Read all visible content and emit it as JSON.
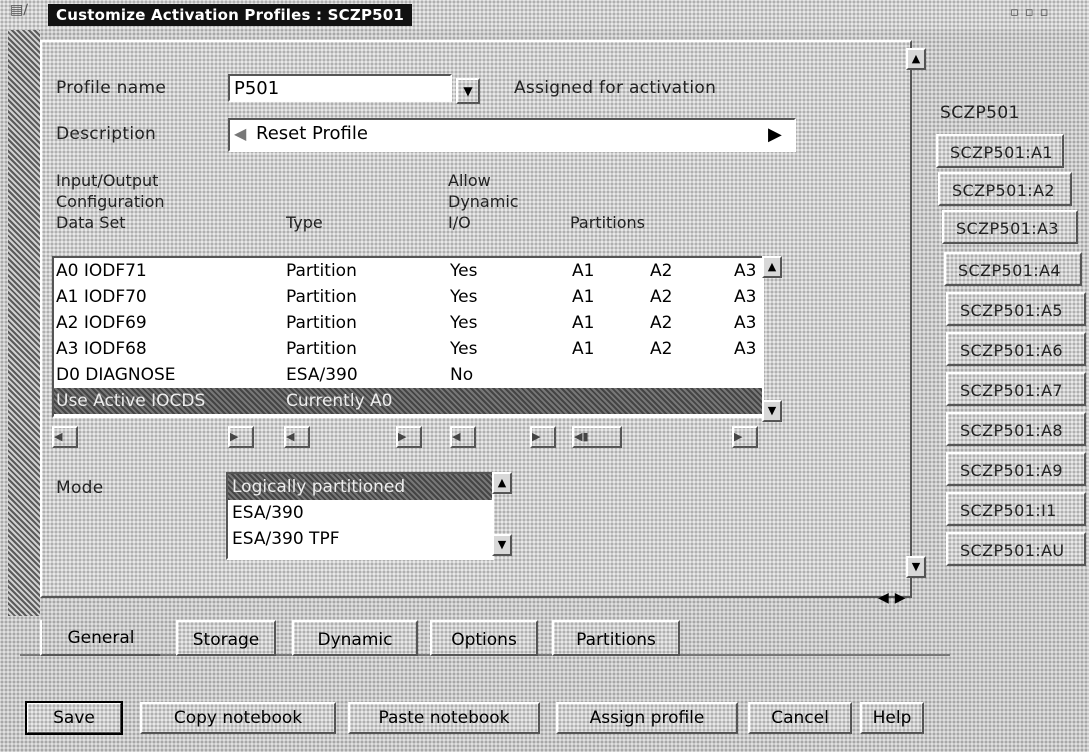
{
  "window": {
    "title": "Customize Activation Profiles : SCZP501"
  },
  "general": {
    "profile_name_label": "Profile name",
    "profile_name_value": "P501",
    "assigned_label": "Assigned for activation",
    "description_label": "Description",
    "description_value": "Reset Profile"
  },
  "iocds_table": {
    "headers": {
      "iocds": [
        "Input/Output",
        "Configuration",
        "Data Set"
      ],
      "type": "Type",
      "dynamic_io": [
        "Allow",
        "Dynamic",
        "I/O"
      ],
      "partitions": "Partitions"
    },
    "rows": [
      {
        "ds": "A0 IODF71",
        "type": "Partition",
        "io": "Yes",
        "p1": "A1",
        "p2": "A2",
        "p3": "A3"
      },
      {
        "ds": "A1 IODF70",
        "type": "Partition",
        "io": "Yes",
        "p1": "A1",
        "p2": "A2",
        "p3": "A3"
      },
      {
        "ds": "A2 IODF69",
        "type": "Partition",
        "io": "Yes",
        "p1": "A1",
        "p2": "A2",
        "p3": "A3"
      },
      {
        "ds": "A3 IODF68",
        "type": "Partition",
        "io": "Yes",
        "p1": "A1",
        "p2": "A2",
        "p3": "A3"
      },
      {
        "ds": "D0 DIAGNOSE",
        "type": "ESA/390",
        "io": "No",
        "p1": "",
        "p2": "",
        "p3": ""
      },
      {
        "ds": "Use Active IOCDS",
        "type": "Currently A0",
        "io": "",
        "p1": "",
        "p2": "",
        "p3": ""
      }
    ],
    "selected_index": 5
  },
  "mode": {
    "label": "Mode",
    "options": [
      "Logically partitioned",
      "ESA/390",
      "ESA/390 TPF"
    ],
    "selected_index": 0
  },
  "right_tabs": {
    "header": "SCZP501",
    "items": [
      "SCZP501:A1",
      "SCZP501:A2",
      "SCZP501:A3",
      "SCZP501:A4",
      "SCZP501:A5",
      "SCZP501:A6",
      "SCZP501:A7",
      "SCZP501:A8",
      "SCZP501:A9",
      "SCZP501:I1",
      "SCZP501:AU"
    ]
  },
  "bottom_tabs": [
    "General",
    "Storage",
    "Dynamic",
    "Options",
    "Partitions"
  ],
  "active_bottom_tab": "General",
  "buttons": {
    "save": "Save",
    "copy": "Copy notebook",
    "paste": "Paste notebook",
    "assign": "Assign profile",
    "cancel": "Cancel",
    "help": "Help"
  }
}
